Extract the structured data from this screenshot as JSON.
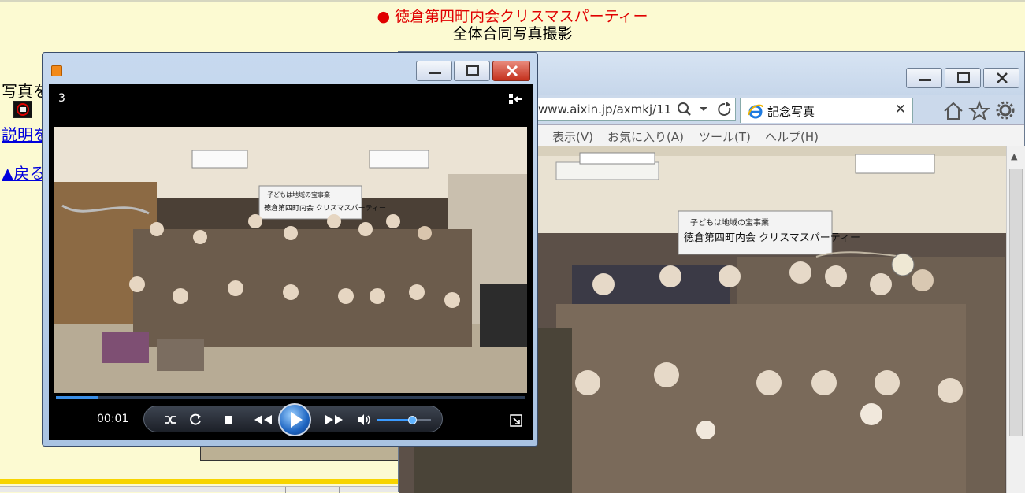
{
  "page": {
    "title_bullet": "●",
    "title_main": "徳倉第四町内会クリスマスパーティー",
    "subtitle": "全体合同写真撮影",
    "left_text": "写真を",
    "link_1": "説明を",
    "link_2": "▲戻る",
    "accent_red": "#e00000",
    "background": "#fcfad2"
  },
  "browser": {
    "address": "www.aixin.jp/axmkj/11",
    "tab_title": "記念写真",
    "tab_close": "✕",
    "menu": [
      "表示(V)",
      "お気に入り(A)",
      "ツール(T)",
      "ヘルプ(H)"
    ],
    "icons": [
      "ie-logo-icon",
      "search-icon",
      "dropdown-icon",
      "refresh-icon",
      "home-icon",
      "star-icon",
      "gear-icon"
    ]
  },
  "photo": {
    "banner_line1": "子どもは地域の宝事業",
    "banner_line2": "徳倉第四町内会 クリスマスパーティー"
  },
  "player": {
    "counter": "3",
    "time": "00:01",
    "progress": 0.09,
    "volume": 0.65,
    "icons": [
      "shuffle-icon",
      "repeat-icon",
      "stop-icon",
      "previous-icon",
      "play-icon",
      "next-icon",
      "volume-icon",
      "switch-to-library-icon",
      "fullscreen-icon"
    ]
  }
}
